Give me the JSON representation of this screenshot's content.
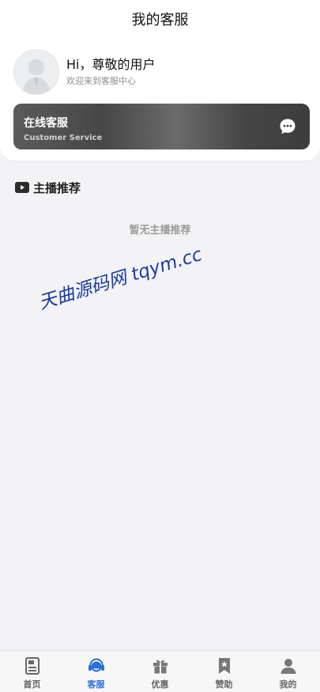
{
  "header": {
    "title": "我的客服"
  },
  "profile": {
    "greeting": "Hi，尊敬的用户",
    "subtitle": "欢迎来到客服中心"
  },
  "service_card": {
    "title": "在线客服",
    "subtitle": "Customer Service",
    "icon": "chat-bubble-icon"
  },
  "recommend": {
    "icon": "video-play-icon",
    "title": "主播推荐",
    "empty_text": "暂无主播推荐"
  },
  "watermark": {
    "text": "天曲源码网 tqym.cc"
  },
  "tabbar": {
    "active_color": "#2c6fd6",
    "items": [
      {
        "label": "首页",
        "icon": "document-icon",
        "active": false
      },
      {
        "label": "客服",
        "icon": "headset-icon",
        "active": true
      },
      {
        "label": "优惠",
        "icon": "gift-icon",
        "active": false
      },
      {
        "label": "赞助",
        "icon": "bookmark-star-icon",
        "active": false
      },
      {
        "label": "我的",
        "icon": "user-icon",
        "active": false
      }
    ]
  }
}
